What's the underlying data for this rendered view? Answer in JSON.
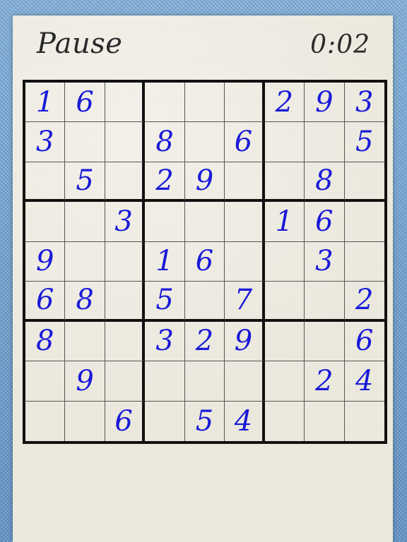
{
  "header": {
    "pause_label": "Pause",
    "timer": "0:02"
  },
  "colors": {
    "digit": "#1a1ad8",
    "grid": "#111111",
    "paper": "#ece9de",
    "frame": "#6b9fcf"
  },
  "board": {
    "rows": [
      [
        "1",
        "6",
        "",
        "",
        "",
        "",
        "2",
        "9",
        "3"
      ],
      [
        "3",
        "",
        "",
        "8",
        "",
        "6",
        "",
        "",
        "5"
      ],
      [
        "",
        "5",
        "",
        "2",
        "9",
        "",
        "",
        "8",
        ""
      ],
      [
        "",
        "",
        "3",
        "",
        "",
        "",
        "1",
        "6",
        ""
      ],
      [
        "9",
        "",
        "",
        "1",
        "6",
        "",
        "",
        "3",
        ""
      ],
      [
        "6",
        "8",
        "",
        "5",
        "",
        "7",
        "",
        "",
        "2"
      ],
      [
        "8",
        "",
        "",
        "3",
        "2",
        "9",
        "",
        "",
        "6"
      ],
      [
        "",
        "9",
        "",
        "",
        "",
        "",
        "",
        "2",
        "4"
      ],
      [
        "",
        "",
        "6",
        "",
        "5",
        "4",
        "",
        "",
        ""
      ]
    ]
  }
}
